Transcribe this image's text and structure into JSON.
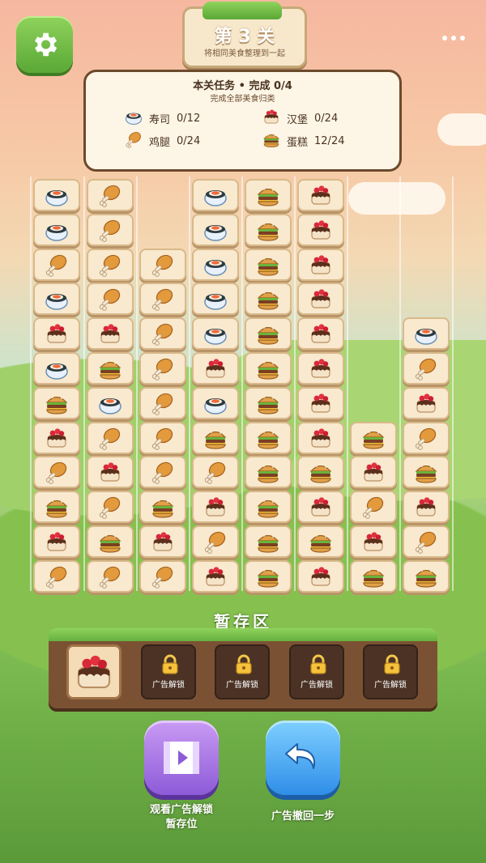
{
  "level": {
    "title": "第 3 关",
    "subtitle": "将相同美食整理到一起"
  },
  "task": {
    "title": "本关任务 • 完成 0/4",
    "subtitle": "完成全部美食归类",
    "items": [
      {
        "icon": "sushi-icon",
        "name": "寿司",
        "progress": "0/12"
      },
      {
        "icon": "cake-icon",
        "name": "汉堡",
        "progress": "0/24"
      },
      {
        "icon": "drumstick-icon",
        "name": "鸡腿",
        "progress": "0/24"
      },
      {
        "icon": "burger-icon",
        "name": "蛋糕",
        "progress": "12/24"
      }
    ]
  },
  "board": {
    "columns": [
      [
        "sushi",
        "sushi",
        "chicken",
        "sushi",
        "cake",
        "sushi",
        "burger",
        "cake",
        "chicken",
        "burger",
        "cake",
        "chicken"
      ],
      [
        "chicken",
        "chicken",
        "chicken",
        "chicken",
        "cake",
        "burger",
        "sushi",
        "chicken",
        "cake",
        "chicken",
        "burger",
        "chicken"
      ],
      [
        "chicken",
        "chicken",
        "chicken",
        "chicken",
        "chicken",
        "chicken",
        "chicken",
        "burger",
        "cake",
        "chicken"
      ],
      [
        "sushi",
        "sushi",
        "sushi",
        "sushi",
        "sushi",
        "cake",
        "sushi",
        "burger",
        "chicken",
        "cake",
        "chicken",
        "cake"
      ],
      [
        "burger",
        "burger",
        "burger",
        "burger",
        "burger",
        "burger",
        "burger",
        "burger",
        "burger",
        "burger",
        "burger",
        "burger"
      ],
      [
        "cake",
        "cake",
        "cake",
        "cake",
        "cake",
        "cake",
        "cake",
        "cake",
        "burger",
        "cake",
        "burger",
        "cake"
      ],
      [
        "burger",
        "cake",
        "chicken",
        "cake",
        "burger"
      ],
      [
        "sushi",
        "chicken",
        "cake",
        "chicken",
        "burger",
        "cake",
        "chicken",
        "burger"
      ]
    ]
  },
  "storage": {
    "title": "暂存区",
    "slots": [
      {
        "state": "open",
        "item": "cake"
      },
      {
        "state": "locked",
        "label": "广告解锁"
      },
      {
        "state": "locked",
        "label": "广告解锁"
      },
      {
        "state": "locked",
        "label": "广告解锁"
      },
      {
        "state": "locked",
        "label": "广告解锁"
      }
    ]
  },
  "actions": {
    "watch_ad_label_1": "观看广告解锁",
    "watch_ad_label_2": "暂存位",
    "undo_label": "广告撤回一步"
  },
  "colors": {
    "accent_green": "#5aa836",
    "panel_brown": "#7a5233",
    "purple": "#8d5bd8",
    "blue": "#2f8ee8"
  }
}
